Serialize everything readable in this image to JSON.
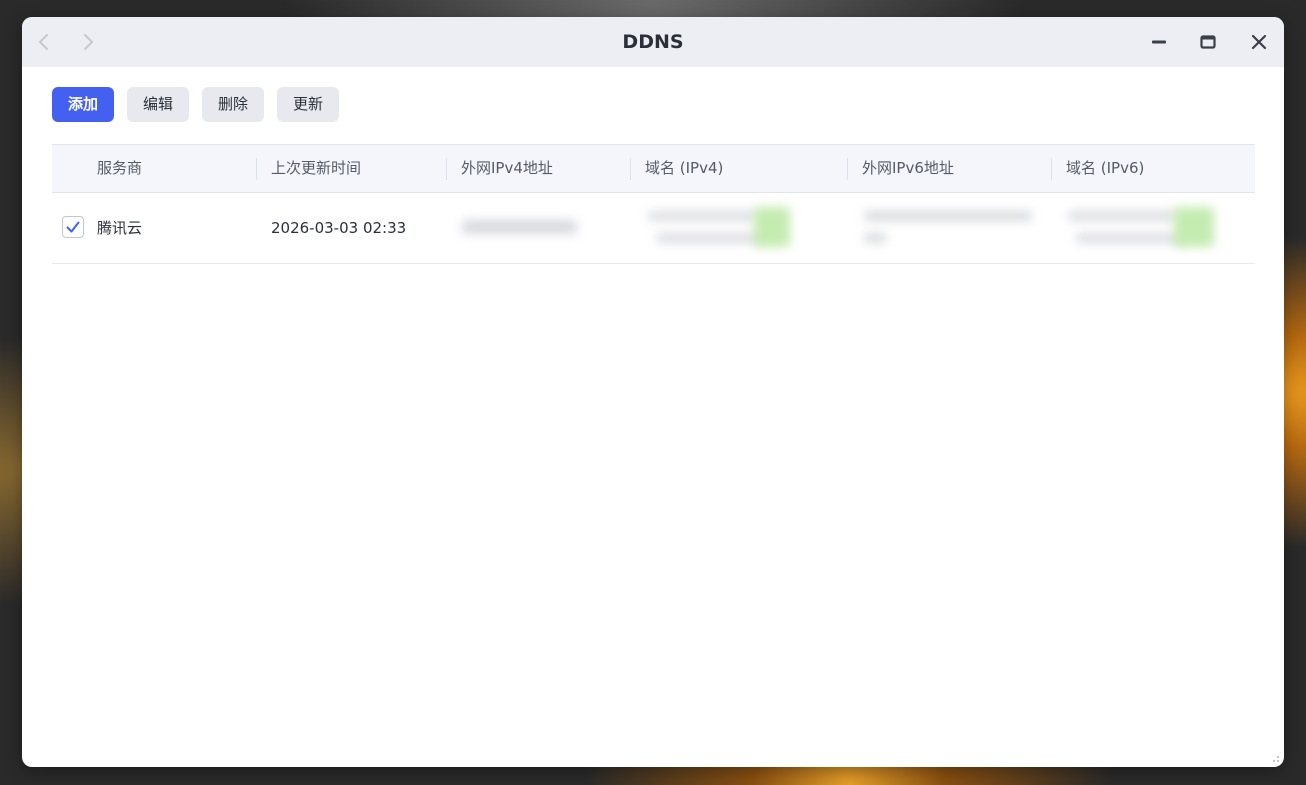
{
  "window": {
    "title": "DDNS"
  },
  "toolbar": {
    "add_label": "添加",
    "edit_label": "编辑",
    "delete_label": "删除",
    "update_label": "更新"
  },
  "table": {
    "columns": [
      "服务商",
      "上次更新时间",
      "外网IPv4地址",
      "域名 (IPv4)",
      "外网IPv6地址",
      "域名 (IPv6)"
    ],
    "rows": [
      {
        "checked": true,
        "provider": "腾讯云",
        "last_update": "2026-03-03 02:33"
      }
    ]
  },
  "colors": {
    "accent": "#4460f0",
    "titlebar": "#edeef3",
    "header_bg": "#f5f6fb"
  }
}
